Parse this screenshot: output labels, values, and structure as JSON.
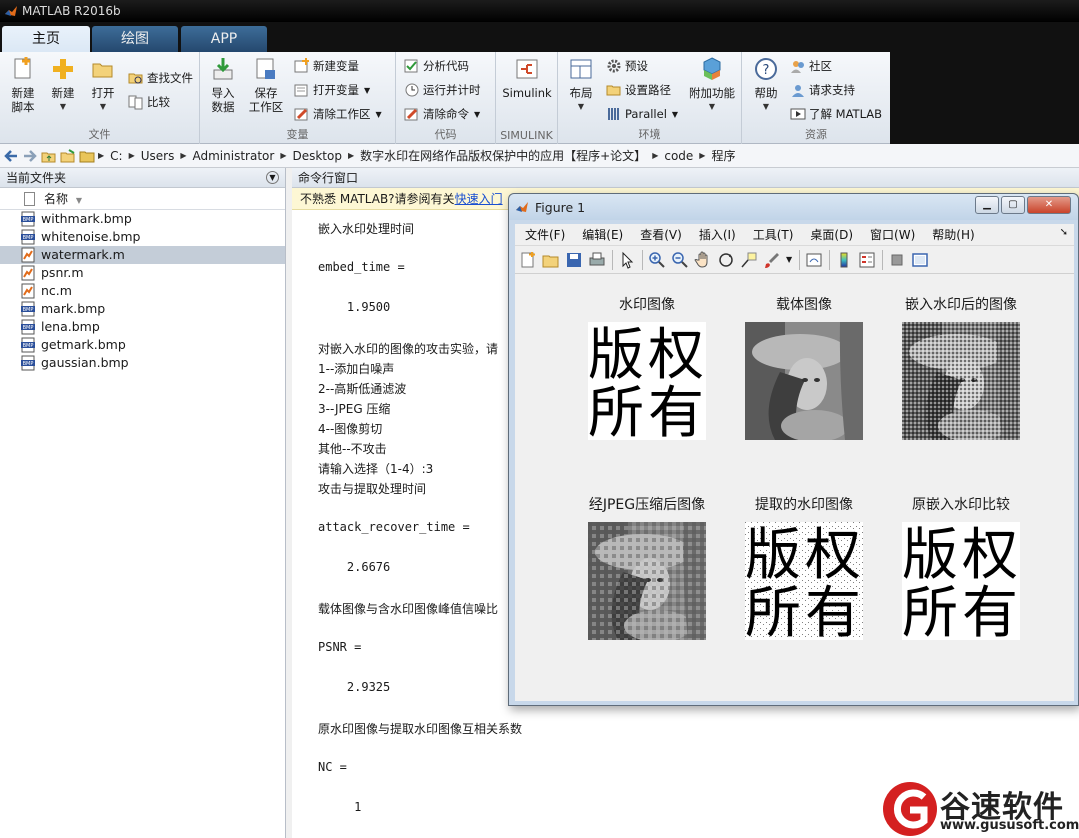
{
  "app": {
    "title": "MATLAB R2016b"
  },
  "tabs": [
    {
      "label": "主页"
    },
    {
      "label": "绘图"
    },
    {
      "label": "APP"
    }
  ],
  "ribbon": {
    "file_group": {
      "label": "文件",
      "new_script": "新建\n脚本",
      "new": "新建",
      "open": "打开",
      "find_files": "查找文件",
      "compare": "比较"
    },
    "variable_group": {
      "label": "变量",
      "import": "导入\n数据",
      "save_ws": "保存\n工作区",
      "new_var": "新建变量",
      "open_var": "打开变量",
      "clear_ws": "清除工作区"
    },
    "code_group": {
      "label": "代码",
      "analyze": "分析代码",
      "run_time": "运行并计时",
      "clear_cmd": "清除命令"
    },
    "simulink_group": {
      "label": "SIMULINK",
      "simulink": "Simulink"
    },
    "env_group": {
      "label": "环境",
      "layout": "布局",
      "prefs": "预设",
      "set_path": "设置路径",
      "parallel": "Parallel",
      "addons": "附加功能"
    },
    "resources_group": {
      "label": "资源",
      "help": "帮助",
      "community": "社区",
      "request_support": "请求支持",
      "learn": "了解 MATLAB"
    }
  },
  "address": {
    "crumbs": [
      "C:",
      "Users",
      "Administrator",
      "Desktop",
      "数字水印在网络作品版权保护中的应用【程序+论文】",
      "code",
      "程序"
    ]
  },
  "current_folder": {
    "title": "当前文件夹",
    "column_name": "名称",
    "files": [
      {
        "name": "withmark.bmp",
        "type": "bmp",
        "selected": false
      },
      {
        "name": "whitenoise.bmp",
        "type": "bmp",
        "selected": false
      },
      {
        "name": "watermark.m",
        "type": "m",
        "selected": true
      },
      {
        "name": "psnr.m",
        "type": "m",
        "selected": false
      },
      {
        "name": "nc.m",
        "type": "m",
        "selected": false
      },
      {
        "name": "mark.bmp",
        "type": "bmp",
        "selected": false
      },
      {
        "name": "lena.bmp",
        "type": "bmp",
        "selected": false
      },
      {
        "name": "getmark.bmp",
        "type": "bmp",
        "selected": false
      },
      {
        "name": "gaussian.bmp",
        "type": "bmp",
        "selected": false
      }
    ]
  },
  "command_window": {
    "title": "命令行窗口",
    "info_prefix": "不熟悉 MATLAB?请参阅有关",
    "info_link": "快速入门",
    "lines": [
      {
        "text": "嵌入水印处理时间",
        "zh": true
      },
      {
        "text": "",
        "zh": false
      },
      {
        "text": "embed_time =",
        "zh": false
      },
      {
        "text": "",
        "zh": false
      },
      {
        "text": "    1.9500",
        "zh": false
      },
      {
        "text": "",
        "zh": false
      },
      {
        "text": "对嵌入水印的图像的攻击实验，请",
        "zh": true
      },
      {
        "text": "1--添加白噪声",
        "zh": true
      },
      {
        "text": "2--高斯低通滤波",
        "zh": true
      },
      {
        "text": "3--JPEG 压缩",
        "zh": true
      },
      {
        "text": "4--图像剪切",
        "zh": true
      },
      {
        "text": "其他--不攻击",
        "zh": true
      },
      {
        "text": "请输入选择（1-4）:3",
        "zh": true
      },
      {
        "text": "攻击与提取处理时间",
        "zh": true
      },
      {
        "text": "",
        "zh": false
      },
      {
        "text": "attack_recover_time =",
        "zh": false
      },
      {
        "text": "",
        "zh": false
      },
      {
        "text": "    2.6676",
        "zh": false
      },
      {
        "text": "",
        "zh": false
      },
      {
        "text": "载体图像与含水印图像峰值信噪比",
        "zh": true
      },
      {
        "text": "",
        "zh": false
      },
      {
        "text": "PSNR =",
        "zh": false
      },
      {
        "text": "",
        "zh": false
      },
      {
        "text": "    2.9325",
        "zh": false
      },
      {
        "text": "",
        "zh": false
      },
      {
        "text": "原水印图像与提取水印图像互相关系数",
        "zh": true
      },
      {
        "text": "",
        "zh": false
      },
      {
        "text": "NC =",
        "zh": false
      },
      {
        "text": "",
        "zh": false
      },
      {
        "text": "     1",
        "zh": false
      }
    ]
  },
  "figure": {
    "title": "Figure 1",
    "menus": [
      "文件(F)",
      "编辑(E)",
      "查看(V)",
      "插入(I)",
      "工具(T)",
      "桌面(D)",
      "窗口(W)",
      "帮助(H)"
    ],
    "plots": [
      {
        "title": "水印图像",
        "kind": "watermark"
      },
      {
        "title": "载体图像",
        "kind": "lena"
      },
      {
        "title": "嵌入水印后的图像",
        "kind": "lena-noisy"
      },
      {
        "title": "经JPEG压缩后图像",
        "kind": "lena-jpeg"
      },
      {
        "title": "提取的水印图像",
        "kind": "watermark-extracted"
      },
      {
        "title": "原嵌入水印比较",
        "kind": "watermark"
      }
    ],
    "watermark_chars": [
      "版",
      "权",
      "所",
      "有"
    ]
  },
  "site_watermark": {
    "brand": "谷速软件",
    "url": "www.gususoft.com"
  }
}
